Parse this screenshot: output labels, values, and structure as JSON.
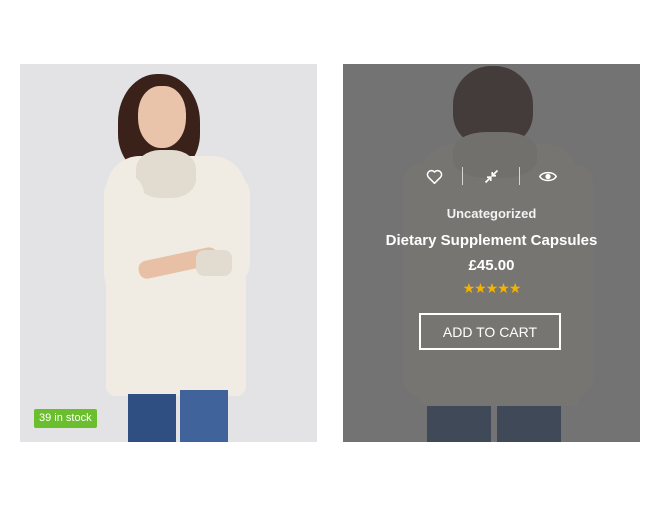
{
  "products": [
    {
      "stock_badge": "39 in stock"
    },
    {
      "category": "Uncategorized",
      "title": "Dietary Supplement Capsules",
      "price": "£45.00",
      "rating_stars": "★★★★★",
      "rating": 5,
      "add_to_cart_label": "ADD TO CART",
      "action_icons": [
        "heart-icon",
        "compare-icon",
        "eye-icon"
      ]
    }
  ],
  "colors": {
    "stock_badge_bg": "#6bbf2e",
    "star_color": "#f5b301",
    "overlay": "rgba(70,70,70,0.72)"
  }
}
